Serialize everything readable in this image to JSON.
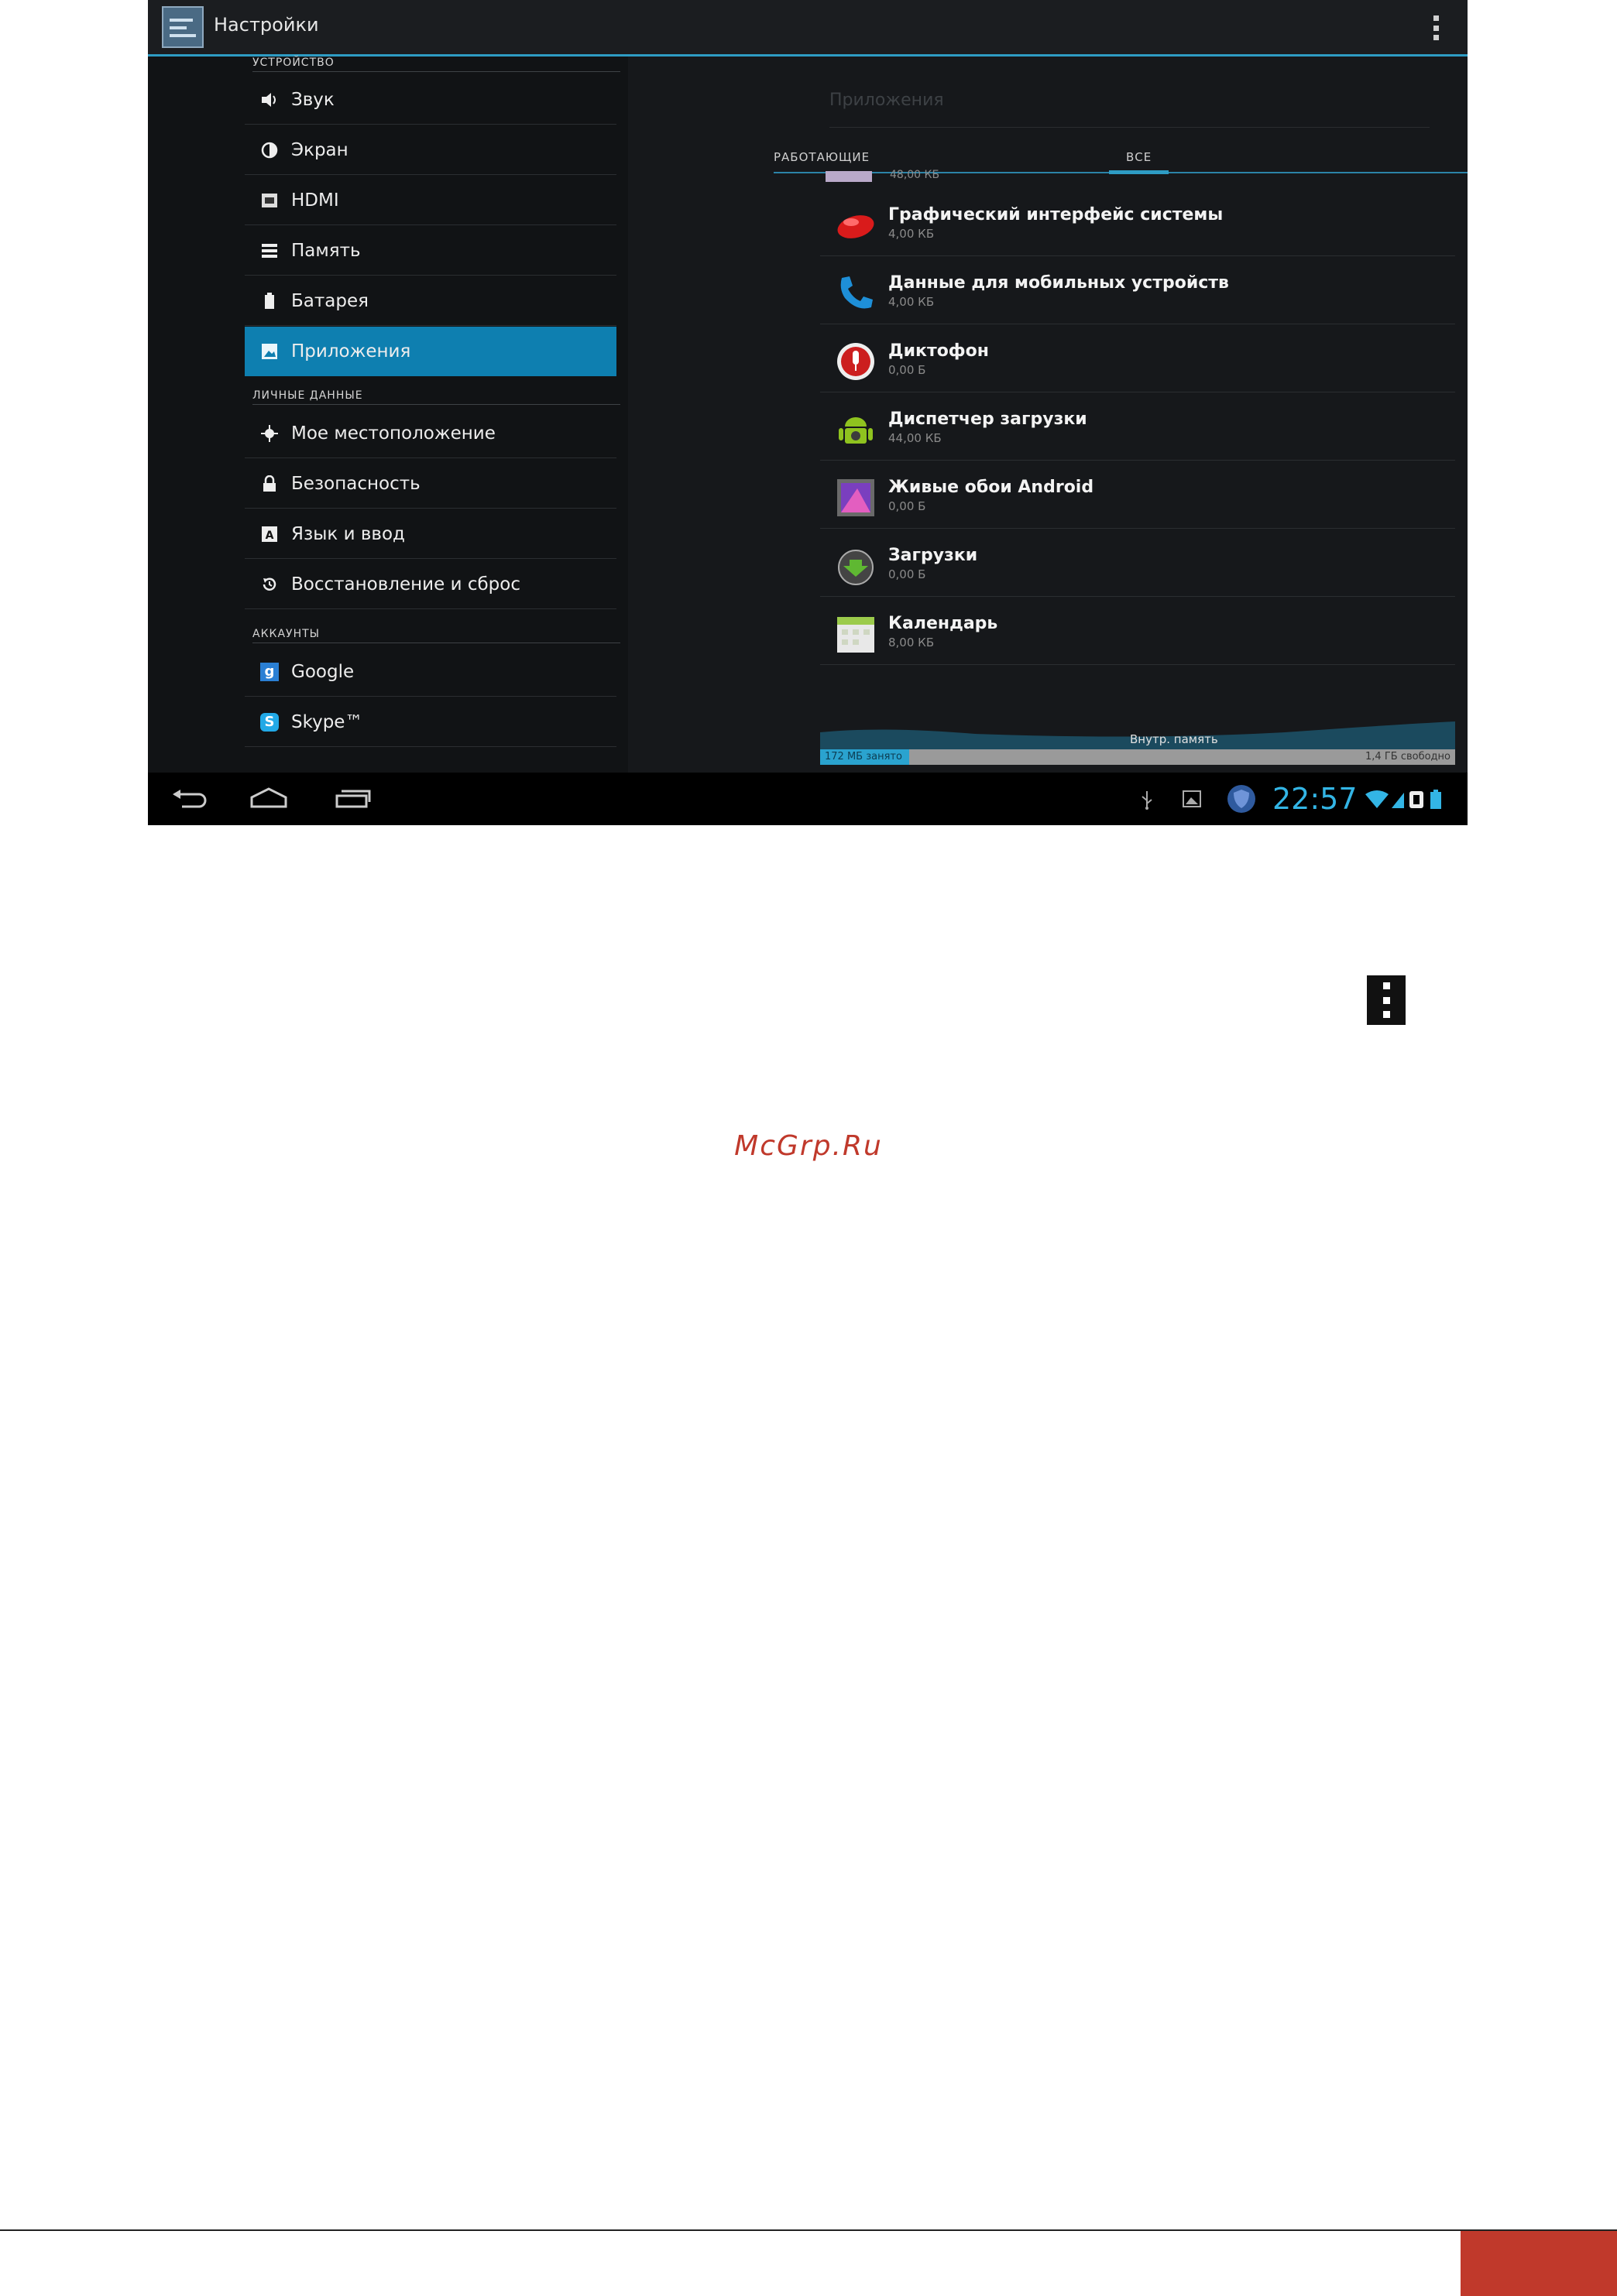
{
  "action_bar": {
    "title": "Настройки"
  },
  "sidebar": {
    "headers": {
      "device": "УСТРОЙСТВО",
      "personal": "ЛИЧНЫЕ ДАННЫЕ",
      "accounts": "АККАУНТЫ"
    },
    "items": [
      {
        "label": "Звук",
        "icon": "speaker-icon"
      },
      {
        "label": "Экран",
        "icon": "brightness-icon"
      },
      {
        "label": "HDMI",
        "icon": "hdmi-icon"
      },
      {
        "label": "Память",
        "icon": "storage-icon"
      },
      {
        "label": "Батарея",
        "icon": "battery-icon"
      },
      {
        "label": "Приложения",
        "icon": "apps-icon",
        "selected": true
      },
      {
        "label": "Мое местоположение",
        "icon": "location-icon"
      },
      {
        "label": "Безопасность",
        "icon": "lock-icon"
      },
      {
        "label": "Язык и ввод",
        "icon": "keyboard-icon"
      },
      {
        "label": "Восстановление и сброс",
        "icon": "restore-icon"
      },
      {
        "label": "Google",
        "icon": "google-icon"
      },
      {
        "label": "Skype™",
        "icon": "skype-icon"
      }
    ]
  },
  "apps_panel": {
    "title": "Приложения",
    "tabs": {
      "running": "РАБОТАЮЩИЕ",
      "all": "ВСЕ"
    },
    "partial_size": "48,00 КБ",
    "apps": [
      {
        "name": "Графический интерфейс системы",
        "size": "4,00 КБ"
      },
      {
        "name": "Данные для мобильных устройств",
        "size": "4,00 КБ"
      },
      {
        "name": "Диктофон",
        "size": "0,00 Б"
      },
      {
        "name": "Диспетчер загрузки",
        "size": "44,00 КБ"
      },
      {
        "name": "Живые обои Android",
        "size": "0,00 Б"
      },
      {
        "name": "Загрузки",
        "size": "0,00 Б"
      },
      {
        "name": "Календарь",
        "size": "8,00 КБ"
      }
    ],
    "storage": {
      "label": "Внутр. память",
      "used": "172 МБ занято",
      "free": "1,4 ГБ свободно",
      "used_fraction": 0.14
    }
  },
  "status_bar": {
    "time": "22:57"
  },
  "document": {
    "watermark": "McGrp.Ru"
  },
  "colors": {
    "accent": "#33b5e5",
    "selected": "#0e7fb0",
    "brand_red": "#c0392b"
  }
}
